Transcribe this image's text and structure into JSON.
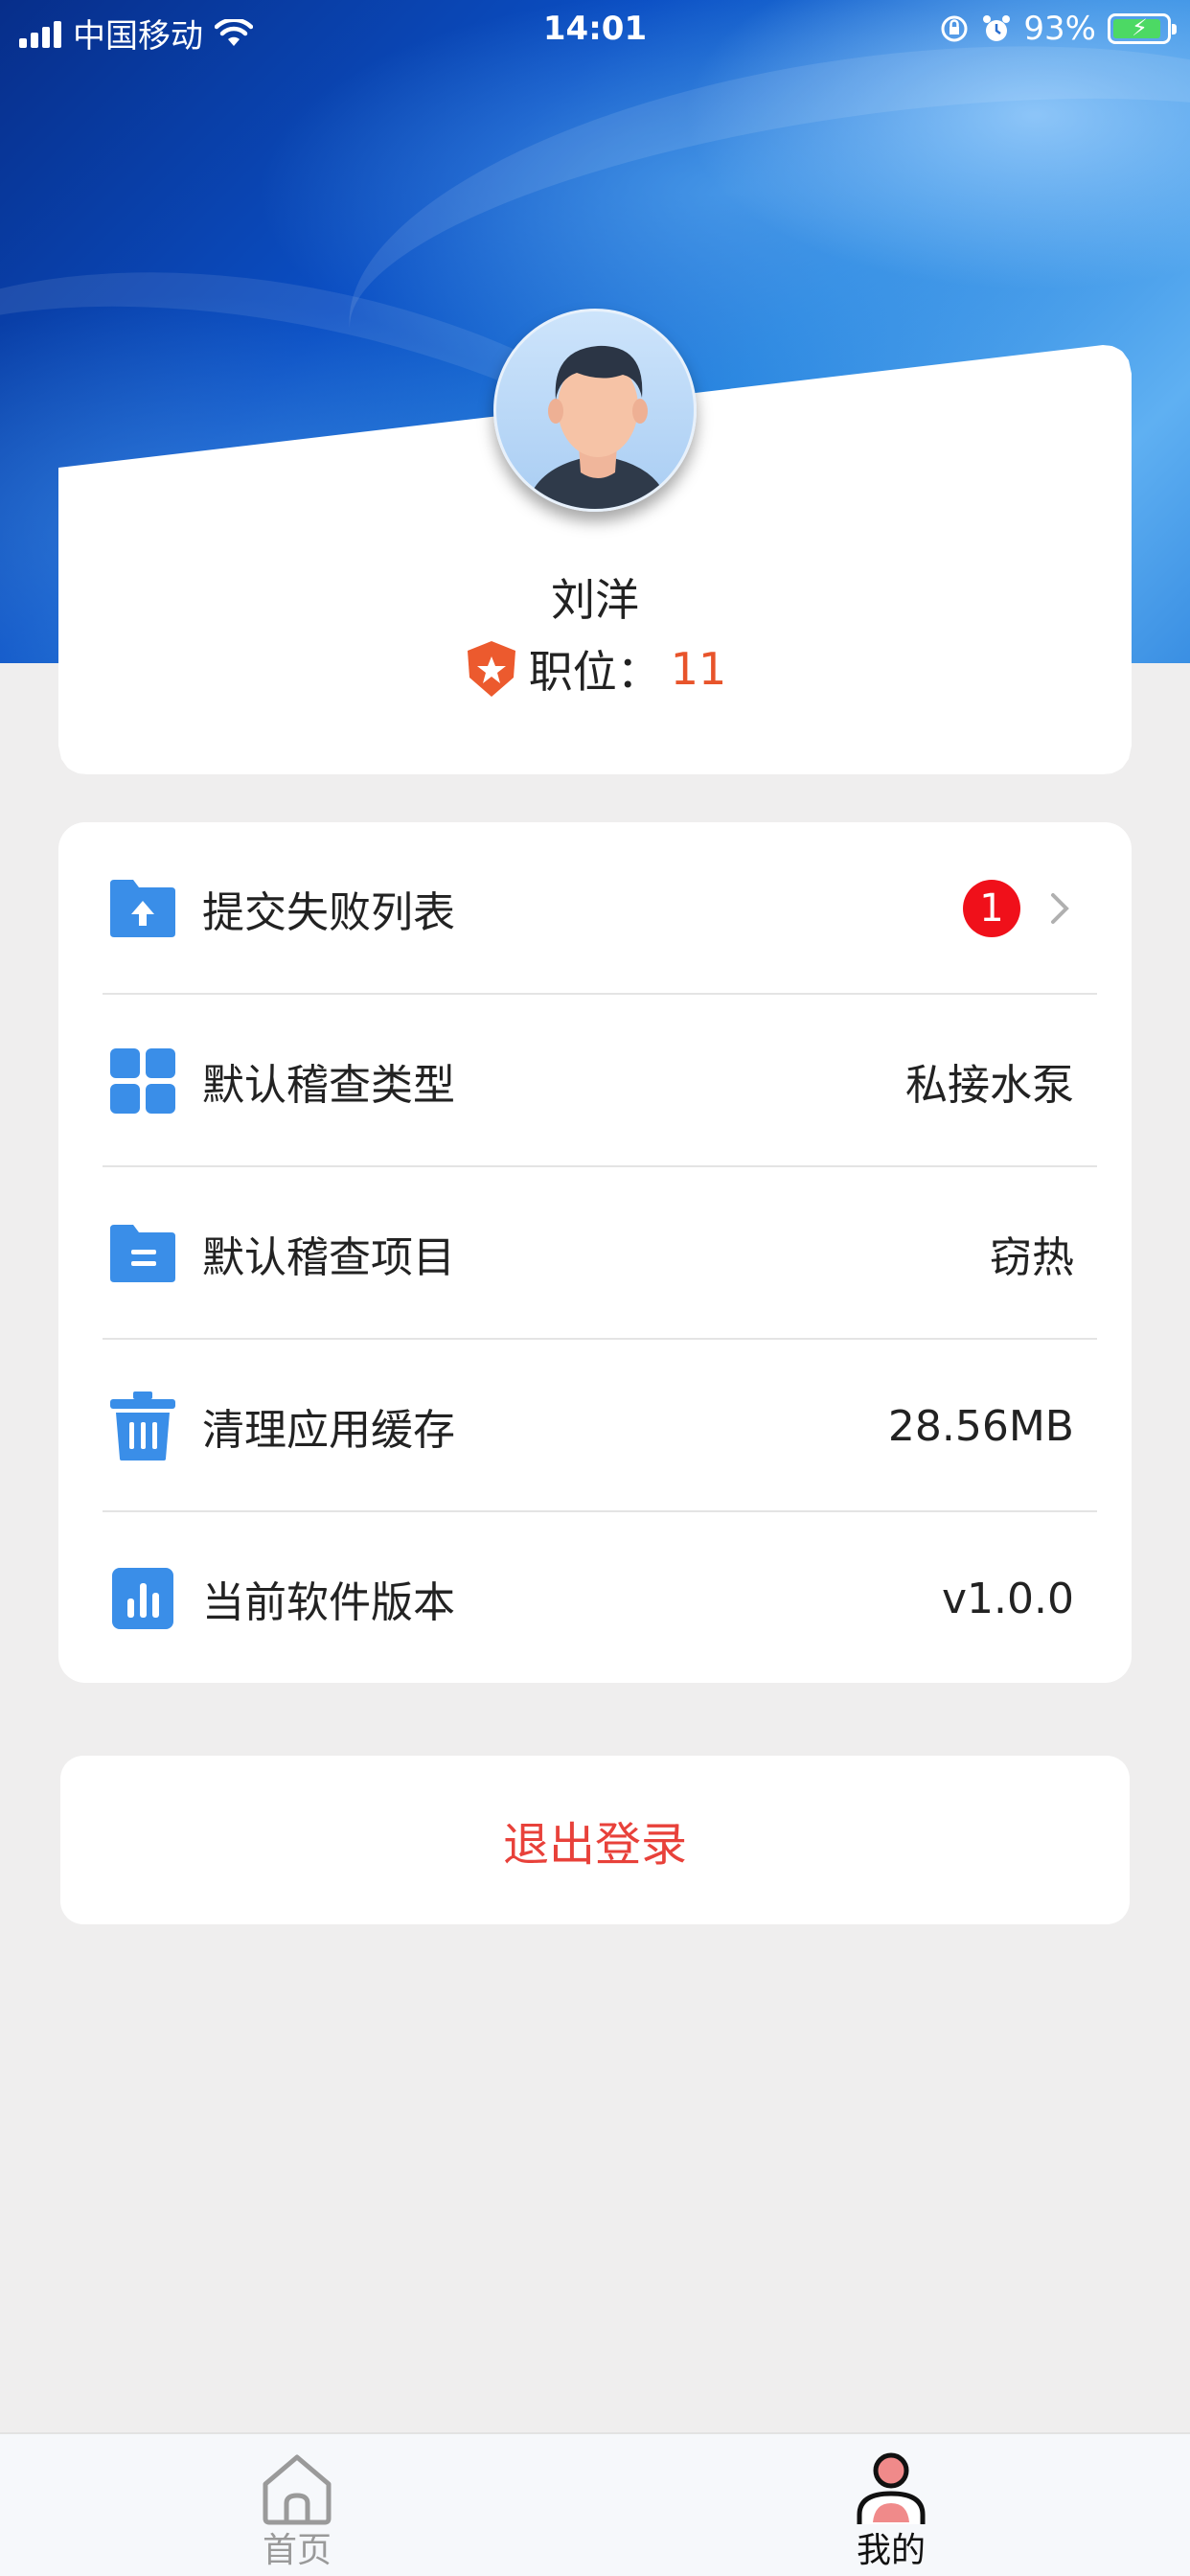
{
  "status_bar": {
    "carrier": "中国移动",
    "time": "14:01",
    "battery_percent": "93%",
    "icons": [
      "signal-icon",
      "wifi-icon",
      "orientation-lock-icon",
      "alarm-icon",
      "battery-charging-icon"
    ]
  },
  "profile": {
    "name": "刘洋",
    "position_label": "职位：",
    "position_value": "11",
    "avatar": "default-male-avatar",
    "badge_icon": "star-shield-icon"
  },
  "settings": {
    "items": [
      {
        "icon": "upload-folder-icon",
        "label": "提交失败列表",
        "badge": "1",
        "chevron": "chevron-right-icon"
      },
      {
        "icon": "grid-icon",
        "label": "默认稽查类型",
        "value": "私接水泵"
      },
      {
        "icon": "document-folder-icon",
        "label": "默认稽查项目",
        "value": "窃热"
      },
      {
        "icon": "trash-icon",
        "label": "清理应用缓存",
        "value": "28.56MB"
      },
      {
        "icon": "bar-chart-icon",
        "label": "当前软件版本",
        "value": "v1.0.0"
      }
    ]
  },
  "logout": {
    "label": "退出登录"
  },
  "tabbar": {
    "tabs": [
      {
        "label": "首页",
        "icon": "home-icon",
        "active": false
      },
      {
        "label": "我的",
        "icon": "user-icon",
        "active": true
      }
    ]
  },
  "colors": {
    "accent_blue": "#3a8ee8",
    "badge_red": "#f0101a",
    "logout_red": "#e8413a",
    "position_orange": "#e8542b",
    "background": "#efeeee"
  }
}
